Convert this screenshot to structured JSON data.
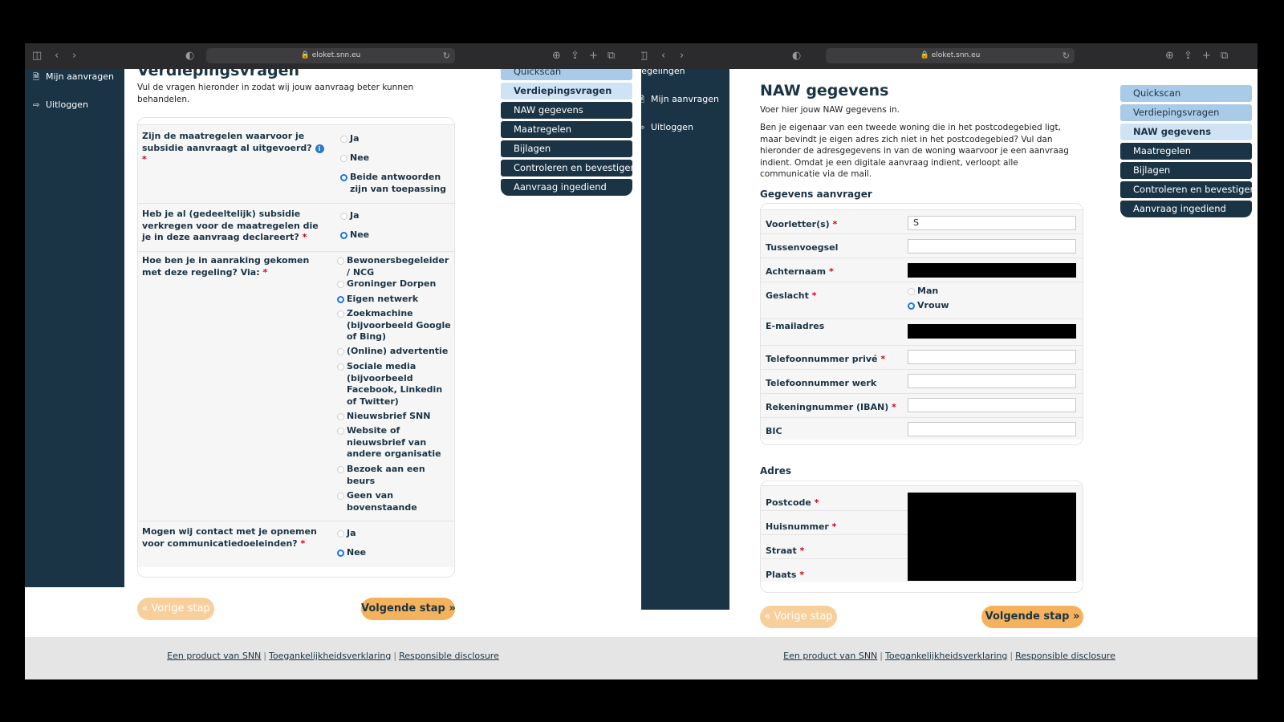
{
  "left": {
    "url": "eloket.snn.eu",
    "sidebar": {
      "items": [
        {
          "label": "Mijn aanvragen"
        },
        {
          "label": "Uitloggen"
        }
      ]
    },
    "title": "Verdiepingsvragen",
    "intro": "Vul de vragen hieronder in zodat wij jouw aanvraag beter kunnen behandelen.",
    "questions": [
      {
        "label": "Zijn de maatregelen waarvoor je subsidie aanvraagt al uitgevoerd?",
        "options": [
          "Ja",
          "Nee",
          "Beide antwoorden zijn van toepassing"
        ],
        "selected": 2
      },
      {
        "label": "Heb je al (gedeeltelijk) subsidie verkregen voor de maatregelen die je in deze aanvraag declareert?",
        "options": [
          "Ja",
          "Nee"
        ],
        "selected": 1
      },
      {
        "label": "Hoe ben je in aanraking gekomen met deze regeling? Via:",
        "options": [
          "Bewonersbegeleider / NCG",
          "Groninger Dorpen",
          "Eigen netwerk",
          "Zoekmachine (bijvoorbeeld Google of Bing)",
          "(Online) advertentie",
          "Sociale media (bijvoorbeeld Facebook, Linkedin of Twitter)",
          "Nieuwsbrief SNN",
          "Website of nieuwsbrief van andere organisatie",
          "Bezoek aan een beurs",
          "Geen van bovenstaande"
        ],
        "selected": 2
      },
      {
        "label": "Mogen wij contact met je opnemen voor communicatiedoeleinden?",
        "options": [
          "Ja",
          "Nee"
        ],
        "selected": 1
      }
    ],
    "required_mark": "*",
    "info_icon": "i",
    "steps": [
      "Quickscan",
      "Verdiepingsvragen",
      "NAW gegevens",
      "Maatregelen",
      "Bijlagen",
      "Controleren en bevestigen",
      "Aanvraag ingediend"
    ],
    "prev_label": "« Vorige stap",
    "next_label": "Volgende stap »"
  },
  "right": {
    "url": "eloket.snn.eu",
    "sidebar": {
      "items": [
        {
          "label": "regelingen"
        },
        {
          "label": "Mijn aanvragen"
        },
        {
          "label": "Uitloggen"
        }
      ]
    },
    "title": "NAW gegevens",
    "intro1": "Voer hier jouw NAW gegevens in.",
    "intro2": "Ben je eigenaar van een tweede woning die in het postcodegebied ligt, maar bevindt je eigen adres zich niet in het postcodegebied? Vul dan hieronder de adresgegevens in van de woning waarvoor je een aanvraag indient. Omdat je een digitale aanvraag indient, verloopt alle communicatie via de mail.",
    "section_applicant": "Gegevens aanvrager",
    "fields": [
      {
        "label": "Voorletter(s)",
        "value": "S"
      },
      {
        "label": "Tussenvoegsel",
        "value": ""
      },
      {
        "label": "Achternaam",
        "value": ""
      },
      {
        "label": "Geslacht",
        "value": ""
      },
      {
        "label": "E-mailadres",
        "value": ""
      },
      {
        "label": "Telefoonnummer privé",
        "value": ""
      },
      {
        "label": "Telefoonnummer werk",
        "value": ""
      },
      {
        "label": "Rekeningnummer (IBAN)",
        "value": ""
      },
      {
        "label": "BIC",
        "value": ""
      }
    ],
    "gender_options": [
      "Man",
      "Vrouw"
    ],
    "gender_selected": 1,
    "section_address": "Adres",
    "address_fields": [
      {
        "label": "Postcode"
      },
      {
        "label": "Huisnummer"
      },
      {
        "label": "Straat"
      },
      {
        "label": "Plaats"
      }
    ],
    "required_mark": "*",
    "steps": [
      "Quickscan",
      "Verdiepingsvragen",
      "NAW gegevens",
      "Maatregelen",
      "Bijlagen",
      "Controleren en bevestigen",
      "Aanvraag ingediend"
    ],
    "prev_label": "« Vorige stap",
    "next_label": "Volgende stap »"
  },
  "footer": {
    "links": [
      "Een product van SNN",
      "Toegankelijkheidsverklaring",
      "Responsible disclosure"
    ],
    "separator": "|"
  },
  "colors": {
    "navy": "#1b3445",
    "step_done": "#a9cbe8",
    "step_active": "#cfe3f5",
    "button_orange": "#f5b25c",
    "required_red": "#d0021b",
    "radio_blue": "#1a73e8"
  }
}
